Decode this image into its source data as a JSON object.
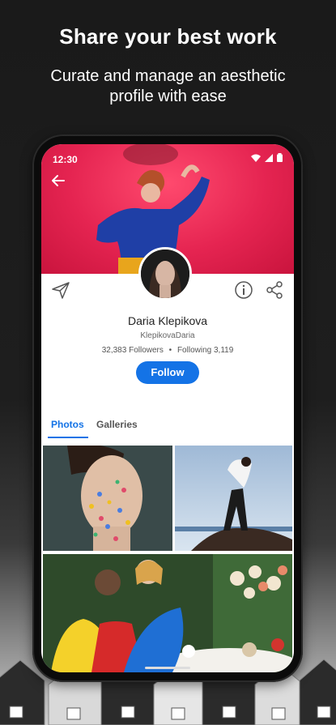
{
  "promo": {
    "title": "Share your best work",
    "subtitle_line1": "Curate and manage an aesthetic",
    "subtitle_line2": "profile with ease"
  },
  "status_bar": {
    "time": "12:30"
  },
  "profile": {
    "name": "Daria Klepikova",
    "handle": "KlepikovaDaria",
    "followers": "32,383 Followers",
    "separator": "•",
    "following": "Following 3,119",
    "follow_label": "Follow"
  },
  "tabs": [
    {
      "label": "Photos",
      "active": true
    },
    {
      "label": "Galleries",
      "active": false
    }
  ],
  "colors": {
    "accent": "#1473e6",
    "cover": "#e52451"
  },
  "icons": [
    "back-arrow-icon",
    "send-icon",
    "info-icon",
    "share-icon",
    "wifi-icon",
    "signal-icon",
    "battery-icon"
  ]
}
